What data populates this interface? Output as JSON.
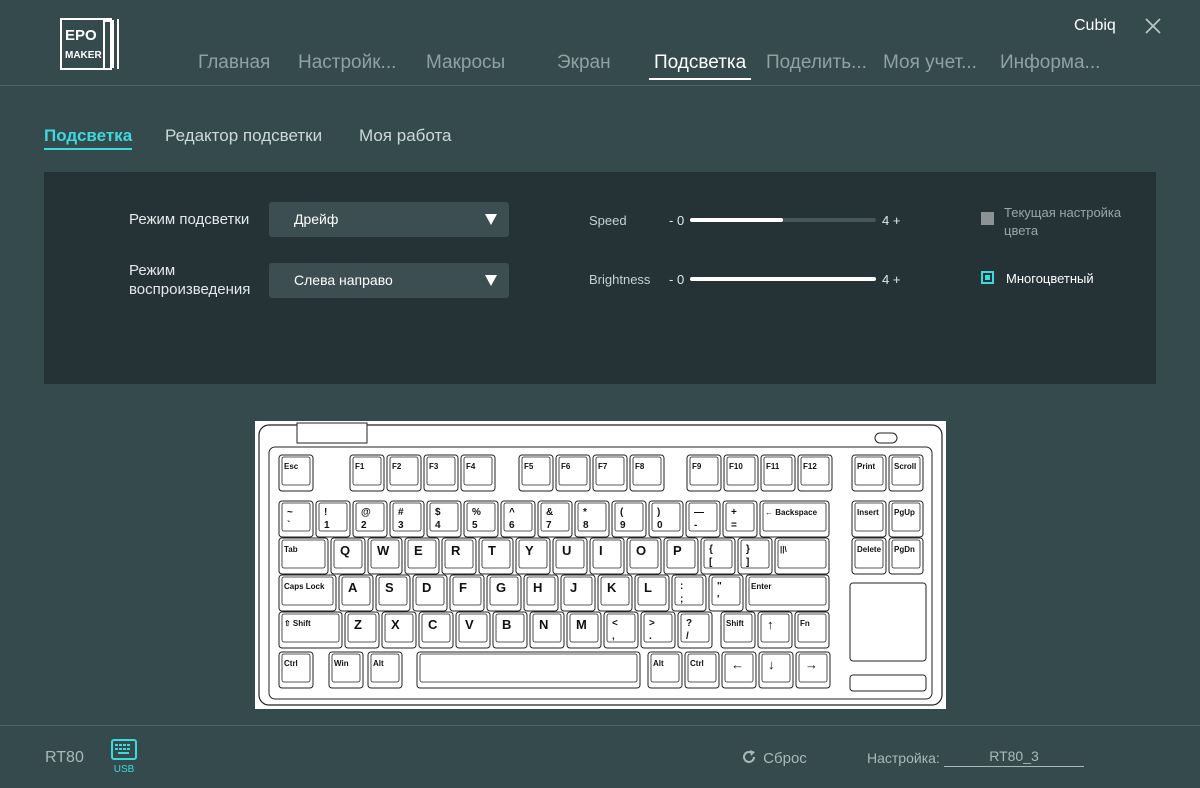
{
  "header": {
    "logo_text": "EPOMAKER",
    "user_name": "Cubiq",
    "tabs": [
      {
        "label": "Главная",
        "active": false
      },
      {
        "label": "Настройк...",
        "active": false
      },
      {
        "label": "Макросы",
        "active": false
      },
      {
        "label": "Экран",
        "active": false
      },
      {
        "label": "Подсветка",
        "active": true
      },
      {
        "label": "Поделить...",
        "active": false
      },
      {
        "label": "Моя учет...",
        "active": false
      },
      {
        "label": "Информа...",
        "active": false
      }
    ]
  },
  "subtabs": [
    {
      "label": "Подсветка",
      "active": true
    },
    {
      "label": "Редактор подсветки",
      "active": false
    },
    {
      "label": "Моя работа",
      "active": false
    }
  ],
  "panel": {
    "mode_label": "Режим подсветки",
    "mode_value": "Дрейф",
    "playback_label_1": "Режим",
    "playback_label_2": "воспроизведения",
    "playback_value": "Слева направо",
    "speed": {
      "label": "Speed",
      "min_text": "- 0",
      "max_text": "4 +",
      "value": 2,
      "max": 4
    },
    "brightness": {
      "label": "Brightness",
      "min_text": "- 0",
      "max_text": "4 +",
      "value": 4,
      "max": 4
    },
    "current_color": {
      "label_1": "Текущая настройка",
      "label_2": "цвета",
      "checked": false
    },
    "multicolor": {
      "label": "Многоцветный",
      "checked": true
    }
  },
  "keyboard": {
    "rows": [
      [
        "Esc",
        "F1",
        "F2",
        "F3",
        "F4",
        "F5",
        "F6",
        "F7",
        "F8",
        "F9",
        "F10",
        "F11",
        "F12",
        "Print",
        "Scroll"
      ],
      [
        "~|`",
        "!|1",
        "@|2",
        "#|3",
        "$|4",
        "%|5",
        "^|6",
        "&|7",
        "*|8",
        "(|9",
        ")|0",
        "—|-",
        "+|=",
        "← Backspace",
        "Insert",
        "PgUp"
      ],
      [
        "Tab",
        "Q",
        "W",
        "E",
        "R",
        "T",
        "Y",
        "U",
        "I",
        "O",
        "P",
        "{|[",
        "}|]",
        "||\\",
        "Delete",
        "PgDn"
      ],
      [
        "Caps Lock",
        "A",
        "S",
        "D",
        "F",
        "G",
        "H",
        "J",
        "K",
        "L",
        ":|;",
        "\"|'",
        "Enter"
      ],
      [
        "⇧ Shift",
        "Z",
        "X",
        "C",
        "V",
        "B",
        "N",
        "M",
        "<|,",
        ">|.",
        "?|/",
        "Shift",
        "↑",
        "Fn"
      ],
      [
        "Ctrl",
        "Win",
        "Alt",
        "",
        "Alt",
        "Ctrl",
        "←",
        "↓",
        "→"
      ]
    ]
  },
  "footer": {
    "model": "RT80",
    "connection": "USB",
    "reset_label": "Сброс",
    "setting_label": "Настройка:",
    "setting_value": "RT80_3"
  },
  "colors": {
    "accent": "#3fd8dc",
    "background": "#344a4d",
    "panel": "#263336"
  },
  "icons": [
    "epomaker-logo-icon",
    "close-icon",
    "dropdown-arrow-icon",
    "keyboard-usb-icon",
    "reset-icon"
  ]
}
